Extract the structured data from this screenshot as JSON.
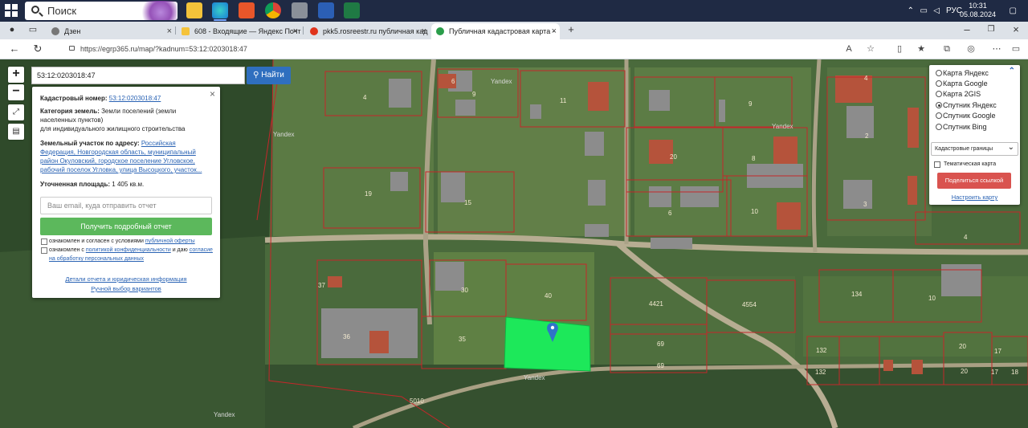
{
  "taskbar": {
    "search_placeholder": "Поиск",
    "lang": "РУС",
    "time": "10:31",
    "date": "05.08.2024"
  },
  "tabs": [
    {
      "label": "Дзен",
      "icon": "zen-icon"
    },
    {
      "label": "608 - Входящие — Яндекс Почт",
      "icon": "yandex-mail-icon"
    },
    {
      "label": "pkk5.rosreestr.ru публичная кад",
      "icon": "yandex-icon"
    },
    {
      "label": "Публичная кадастровая карта -",
      "icon": "check-icon",
      "active": true
    }
  ],
  "address": {
    "url": "https://egrp365.ru/map/?kadnum=53:12:0203018:47"
  },
  "map": {
    "search_value": "53:12:0203018:47",
    "search_button": "Найти",
    "watermark": "Yandex",
    "plot_labels": [
      "4",
      "6",
      "9",
      "11",
      "9",
      "4",
      "2",
      "3",
      "8",
      "19",
      "15",
      "6",
      "10",
      "20",
      "4",
      "37",
      "30",
      "40",
      "4421",
      "4554",
      "134",
      "10",
      "36",
      "35",
      "69",
      "69",
      "132",
      "132",
      "20",
      "20",
      "17",
      "17",
      "18",
      "5010"
    ]
  },
  "info": {
    "cad_label": "Кадастровый номер:",
    "cad_value": "53:12:0203018:47",
    "category_label": "Категория земель:",
    "category_value": "Земли поселений (земли населенных пунктов)",
    "category_use": "для индивидуального жилищного строительства",
    "address_label": "Земельный участок по адресу:",
    "address_value": "Российская Федерация, Новгородская область, муниципальный район Окуловский, городское поселение Угловское, рабочий поселок Угловка, улица Высоцкого, участок...",
    "area_label": "Уточненная площадь:",
    "area_value": "1 405 кв.м.",
    "email_placeholder": "Ваш email, куда отправить отчет",
    "report_button": "Получить подробный отчет",
    "consent1_text": "ознакомлен и согласен с условиями",
    "consent1_link": "публичной оферты",
    "consent2_text": "ознакомлен с",
    "consent2_link": "политикой конфиденциальности",
    "consent2_tail": "и даю",
    "consent2_link2": "согласие на обработку персональных данных",
    "details_link": "Детали отчета и юридическая информация",
    "manual_link": "Ручной выбор вариантов"
  },
  "layers": {
    "options": [
      {
        "label": "Карта Яндекс",
        "selected": false
      },
      {
        "label": "Карта Google",
        "selected": false
      },
      {
        "label": "Карта 2GIS",
        "selected": false
      },
      {
        "label": "Спутник Яндекс",
        "selected": true
      },
      {
        "label": "Спутник Google",
        "selected": false
      },
      {
        "label": "Спутник Bing",
        "selected": false
      }
    ],
    "boundary_select": "Кадастровые границы",
    "thematic": "Тематическая карта",
    "share_button": "Поделиться ссылкой",
    "configure_link": "Настроить карту"
  }
}
